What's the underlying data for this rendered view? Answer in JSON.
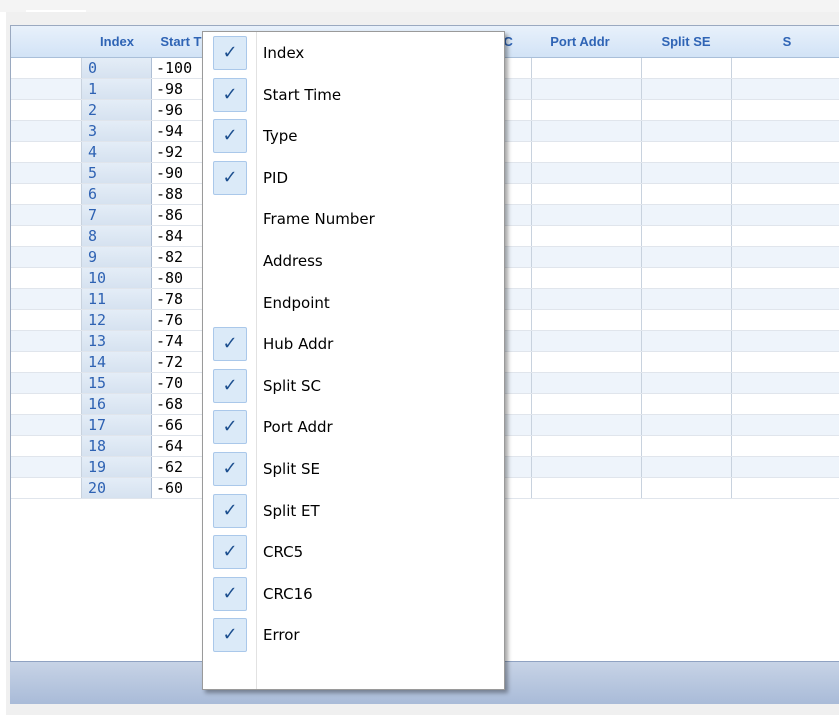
{
  "colors": {
    "header_text": "#2f64b5",
    "header_bg": "#d2e3f6",
    "row_alt_bg": "#eef4fb",
    "check_bg": "#dbeaf8",
    "bottom_bar": "#a9bbd8"
  },
  "grid": {
    "columns": [
      "Index",
      "Start Time",
      "Type",
      "PID",
      "Hub Addr",
      "Split SC",
      "Port Addr",
      "Split SE",
      "S"
    ],
    "rows": [
      {
        "index": "0",
        "start": "-100"
      },
      {
        "index": "1",
        "start": "-98"
      },
      {
        "index": "2",
        "start": "-96"
      },
      {
        "index": "3",
        "start": "-94"
      },
      {
        "index": "4",
        "start": "-92"
      },
      {
        "index": "5",
        "start": "-90"
      },
      {
        "index": "6",
        "start": "-88"
      },
      {
        "index": "7",
        "start": "-86"
      },
      {
        "index": "8",
        "start": "-84"
      },
      {
        "index": "9",
        "start": "-82"
      },
      {
        "index": "10",
        "start": "-80"
      },
      {
        "index": "11",
        "start": "-78"
      },
      {
        "index": "12",
        "start": "-76"
      },
      {
        "index": "13",
        "start": "-74"
      },
      {
        "index": "14",
        "start": "-72"
      },
      {
        "index": "15",
        "start": "-70"
      },
      {
        "index": "16",
        "start": "-68"
      },
      {
        "index": "17",
        "start": "-66"
      },
      {
        "index": "18",
        "start": "-64"
      },
      {
        "index": "19",
        "start": "-62"
      },
      {
        "index": "20",
        "start": "-60"
      }
    ]
  },
  "column_menu": {
    "check_glyph": "✓",
    "items": [
      {
        "label": "Index",
        "checked": true
      },
      {
        "label": "Start Time",
        "checked": true
      },
      {
        "label": "Type",
        "checked": true
      },
      {
        "label": "PID",
        "checked": true
      },
      {
        "label": "Frame Number",
        "checked": false
      },
      {
        "label": "Address",
        "checked": false
      },
      {
        "label": "Endpoint",
        "checked": false
      },
      {
        "label": "Hub Addr",
        "checked": true
      },
      {
        "label": "Split SC",
        "checked": true
      },
      {
        "label": "Port Addr",
        "checked": true
      },
      {
        "label": "Split SE",
        "checked": true
      },
      {
        "label": "Split ET",
        "checked": true
      },
      {
        "label": "CRC5",
        "checked": true
      },
      {
        "label": "CRC16",
        "checked": true
      },
      {
        "label": "Error",
        "checked": true
      }
    ]
  }
}
